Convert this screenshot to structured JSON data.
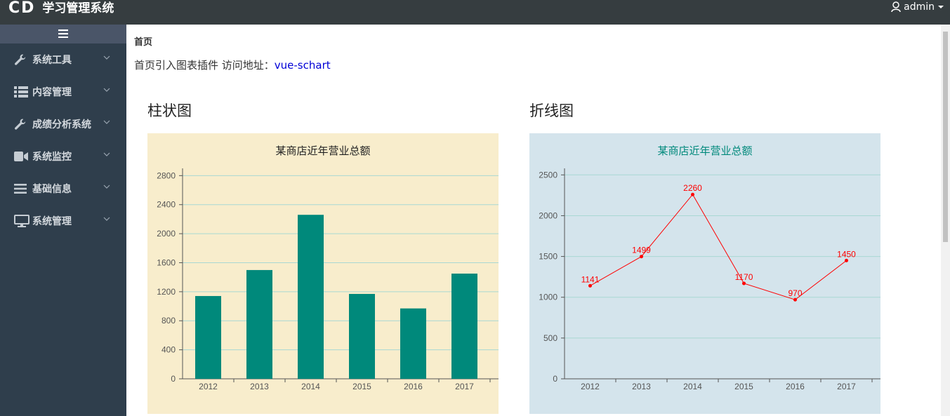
{
  "header": {
    "logo_mark": "CD",
    "app_title": "学习管理系统",
    "user_name": "admin"
  },
  "sidebar": {
    "toggle_icon": "hamburger-icon",
    "items": [
      {
        "label": "系统工具",
        "icon": "wrench-icon"
      },
      {
        "label": "内容管理",
        "icon": "list-icon"
      },
      {
        "label": "成绩分析系统",
        "icon": "wrench-icon"
      },
      {
        "label": "系统监控",
        "icon": "video-icon"
      },
      {
        "label": "基础信息",
        "icon": "bars-icon"
      },
      {
        "label": "系统管理",
        "icon": "monitor-icon"
      }
    ]
  },
  "main": {
    "breadcrumb": "首页",
    "intro_text": "首页引入图表插件 访问地址：",
    "intro_link": "vue-schart",
    "bar_section_title": "柱状图",
    "line_section_title": "折线图"
  },
  "colors": {
    "topbar": "#363d40",
    "sidebar": "#2f3e4c",
    "bar_fill": "#00897b",
    "bar_bg": "#f8edcc",
    "line_bg": "#d4e4ec",
    "line_color": "#ff0000",
    "line_title": "#00897b"
  },
  "chart_data": [
    {
      "type": "bar",
      "title": "某商店近年营业总额",
      "categories": [
        "2012",
        "2013",
        "2014",
        "2015",
        "2016",
        "2017"
      ],
      "values": [
        1141,
        1499,
        2260,
        1170,
        970,
        1450
      ],
      "yticks": [
        0,
        400,
        800,
        1200,
        1600,
        2000,
        2400,
        2800
      ],
      "ylim": [
        0,
        2900
      ],
      "grid": true
    },
    {
      "type": "line",
      "title": "某商店近年营业总额",
      "categories": [
        "2012",
        "2013",
        "2014",
        "2015",
        "2016",
        "2017"
      ],
      "values": [
        1141,
        1499,
        2260,
        1170,
        970,
        1450
      ],
      "yticks": [
        0,
        500,
        1000,
        1500,
        2000,
        2500
      ],
      "ylim": [
        0,
        2580
      ],
      "grid": true,
      "data_labels": true
    }
  ]
}
